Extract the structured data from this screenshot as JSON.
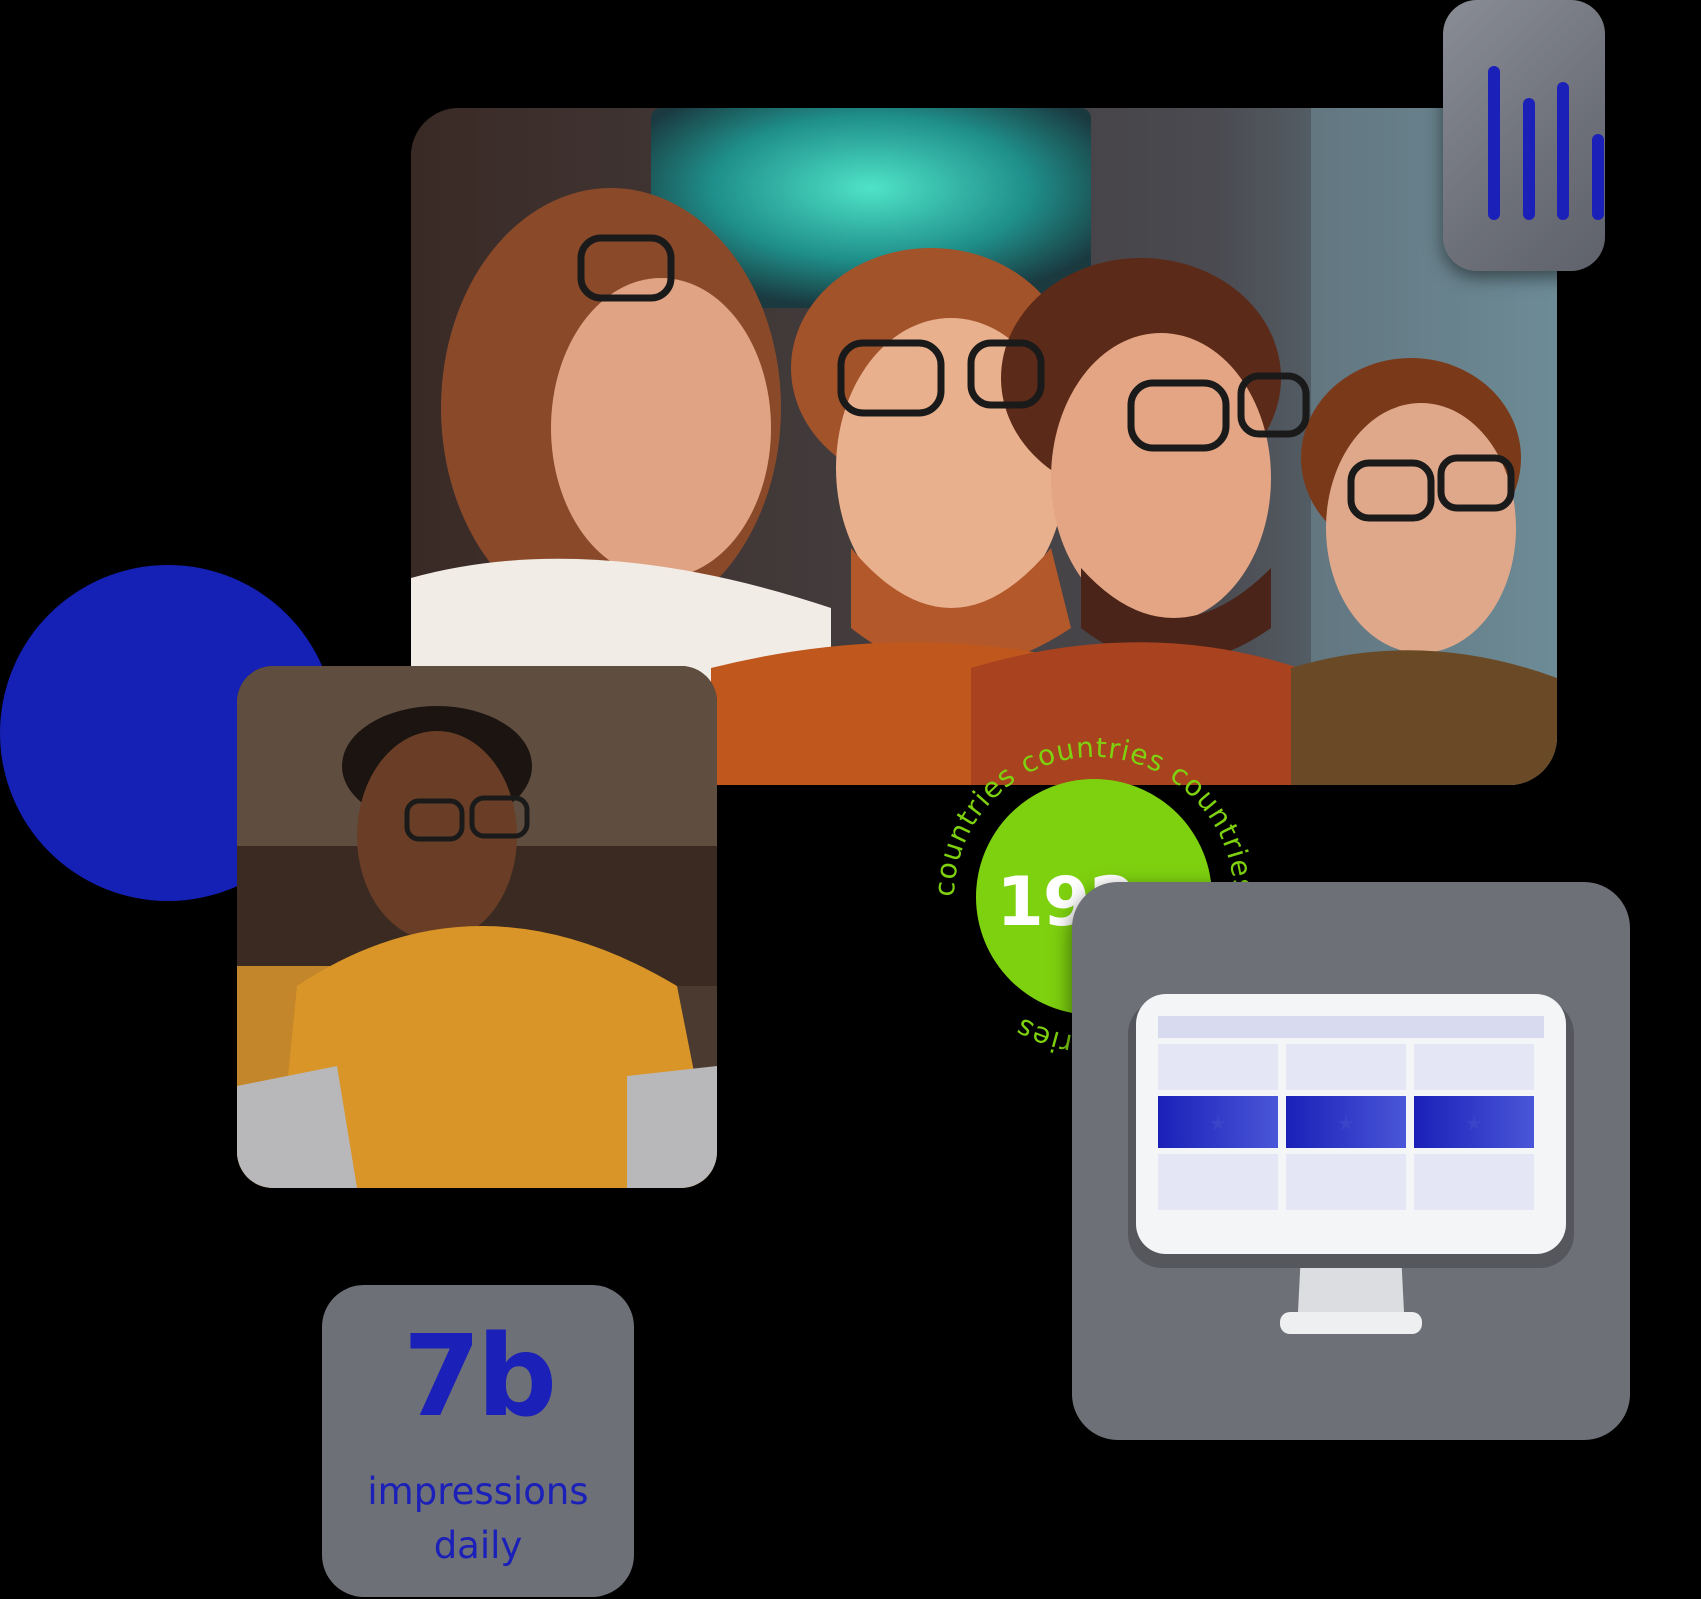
{
  "colors": {
    "background": "#000000",
    "accent_blue": "#1520b4",
    "accent_green": "#7ed10f",
    "tile_gray": "#6e7078"
  },
  "media": {
    "group_photo": "group-photo",
    "single_photo": "single-person-photo"
  },
  "icons": {
    "chart": "bar-chart-icon",
    "monitor": "monitor-table-icon"
  },
  "countries_badge": {
    "value": "192+",
    "ring_text": "countries countries countries countries countries"
  },
  "impressions": {
    "value": "7b",
    "label_line1": "impressions",
    "label_line2": "daily"
  }
}
